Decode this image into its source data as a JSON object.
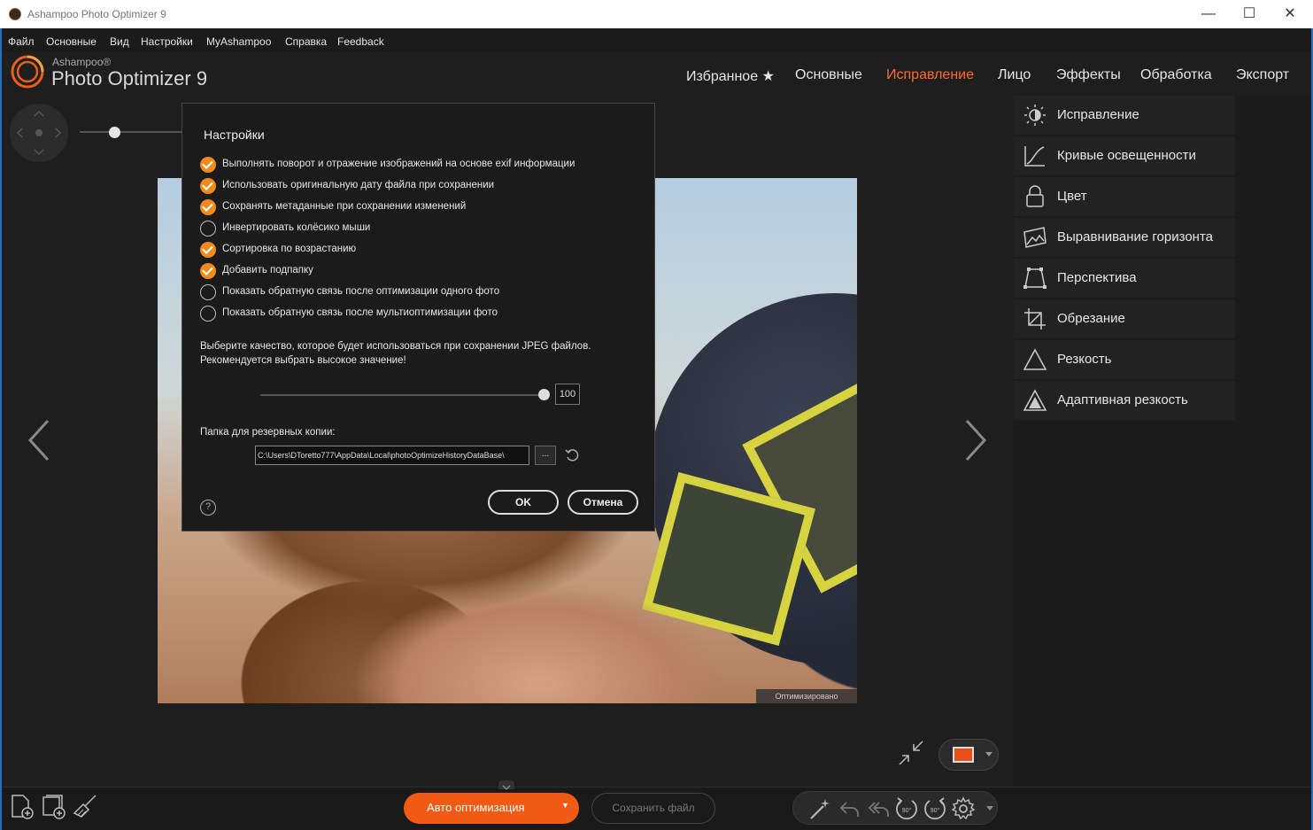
{
  "window": {
    "title": "Ashampoo Photo Optimizer 9",
    "minimize": "—",
    "maximize": "☐",
    "close": "✕"
  },
  "menu": [
    "Файл",
    "Основные",
    "Вид",
    "Настройки",
    "MyAshampoo",
    "Справка",
    "Feedback"
  ],
  "brand": {
    "small": "Ashampoo®",
    "big": "Photo Optimizer 9"
  },
  "topnav": {
    "items": [
      "Избранное ★",
      "Основные",
      "Исправление",
      "Лицо",
      "Эффекты",
      "Обработка",
      "Экспорт"
    ],
    "active_index": 2,
    "active_color": "#ff6a2b"
  },
  "sidepanel": {
    "items": [
      {
        "label": "Исправление",
        "icon": "sun-icon"
      },
      {
        "label": "Кривые освещенности",
        "icon": "curves-icon"
      },
      {
        "label": "Цвет",
        "icon": "color-icon"
      },
      {
        "label": "Выравнивание горизонта",
        "icon": "horizon-icon"
      },
      {
        "label": "Перспектива",
        "icon": "perspective-icon"
      },
      {
        "label": "Обрезание",
        "icon": "crop-icon"
      },
      {
        "label": "Резкость",
        "icon": "sharpness-icon"
      },
      {
        "label": "Адаптивная резкость",
        "icon": "adaptive-sharpness-icon"
      }
    ]
  },
  "photo": {
    "badge": "Оптимизировано"
  },
  "dialog": {
    "title": "Настройки",
    "options": [
      {
        "label": "Выполнять поворот и отражение изображений на основе exif информации",
        "checked": true
      },
      {
        "label": "Использовать оригинальную дату файла при сохранении",
        "checked": true
      },
      {
        "label": "Сохранять метаданные при сохранении изменений",
        "checked": true
      },
      {
        "label": "Инвертировать колёсико мыши",
        "checked": false
      },
      {
        "label": "Сортировка по возрастанию",
        "checked": true
      },
      {
        "label": "Добавить подпапку",
        "checked": true
      },
      {
        "label": "Показать обратную связь после оптимизации одного фото",
        "checked": false
      },
      {
        "label": "Показать обратную связь после мультиоптимизации фото",
        "checked": false
      }
    ],
    "quality_text_1": "Выберите качество, которое будет использоваться при сохранении JPEG файлов.",
    "quality_text_2": "Рекомендуется выбрать высокое значение!",
    "quality_value": "100",
    "backup_label": "Папка для резервных копии:",
    "backup_path": "C:\\Users\\DToretto777\\AppData\\Local\\photoOptimizeHistoryDataBase\\",
    "browse": "...",
    "help": "?",
    "ok": "OK",
    "cancel": "Отмена",
    "accent_color": "#f08a1e"
  },
  "bottom": {
    "auto_optimize": "Авто оптимизация",
    "save_file": "Сохранить файл",
    "auto_color": "#f05a14"
  }
}
